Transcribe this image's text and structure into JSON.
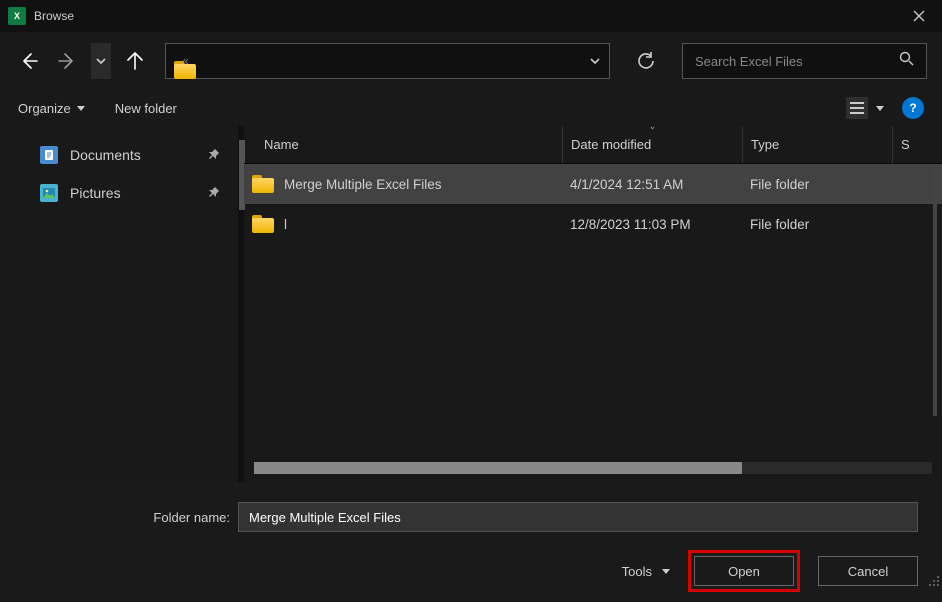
{
  "titlebar": {
    "title": "Browse",
    "icon_text": "X"
  },
  "nav": {
    "breadcrumb_prefix": "«"
  },
  "search": {
    "placeholder": "Search Excel Files"
  },
  "toolbar": {
    "organize": "Organize",
    "new_folder": "New folder"
  },
  "sidebar": {
    "items": [
      {
        "label": "Documents",
        "pin": "📌"
      },
      {
        "label": "Pictures",
        "pin": "📌"
      }
    ]
  },
  "headers": {
    "name": "Name",
    "date": "Date modified",
    "type": "Type",
    "size": "S"
  },
  "files": [
    {
      "name": "Merge Multiple Excel Files",
      "date": "4/1/2024 12:51 AM",
      "type": "File folder",
      "selected": true
    },
    {
      "name": "l",
      "date": "12/8/2023 11:03 PM",
      "type": "File folder",
      "selected": false
    }
  ],
  "bottom": {
    "name_label": "Folder name:",
    "name_value": "Merge Multiple Excel Files",
    "tools": "Tools",
    "open": "Open",
    "cancel": "Cancel"
  }
}
